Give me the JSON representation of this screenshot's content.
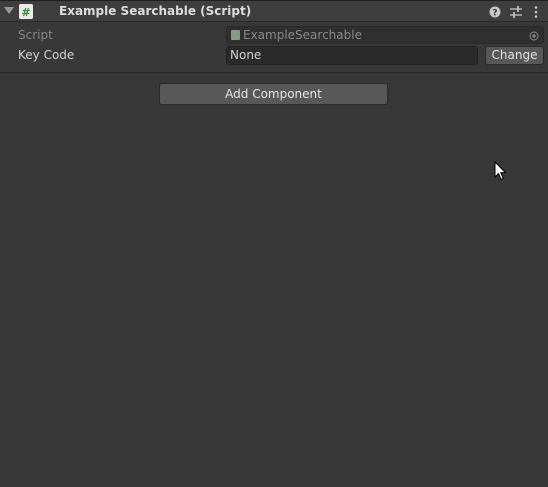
{
  "component": {
    "title": "Example Searchable (Script)",
    "icons": {
      "foldout": "foldout-triangle-icon",
      "script": "csharp-script-icon",
      "help": "help-icon",
      "preset": "preset-sliders-icon",
      "more": "kebab-menu-icon"
    },
    "properties": {
      "script_label": "Script",
      "script_value": "ExampleSearchable",
      "keycode_label": "Key Code",
      "keycode_value": "None",
      "change_label": "Change"
    }
  },
  "add_component_label": "Add Component",
  "colors": {
    "background": "#383838",
    "header": "#3e3e3e",
    "button": "#585858",
    "field": "#2a2a2a"
  }
}
